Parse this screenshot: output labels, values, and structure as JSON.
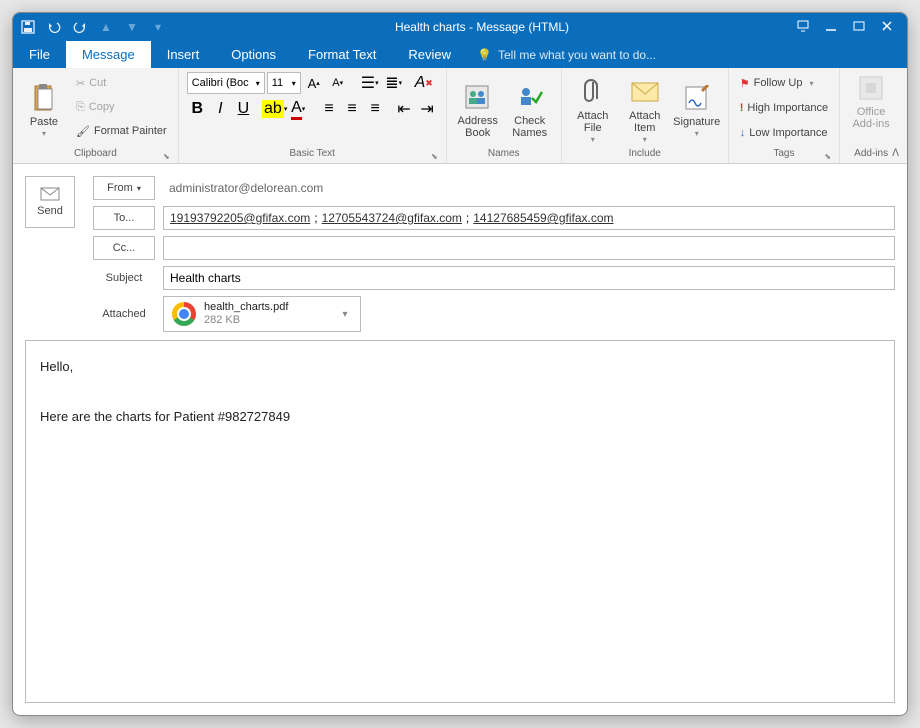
{
  "title": "Health charts - Message (HTML)",
  "menu": {
    "file": "File",
    "message": "Message",
    "insert": "Insert",
    "options": "Options",
    "format": "Format Text",
    "review": "Review",
    "tellme": "Tell me what you want to do..."
  },
  "clipboard": {
    "paste": "Paste",
    "cut": "Cut",
    "copy": "Copy",
    "fmt": "Format Painter",
    "label": "Clipboard"
  },
  "basictext": {
    "font": "Calibri (Boc",
    "size": "11",
    "label": "Basic Text"
  },
  "names": {
    "ab": "Address\nBook",
    "chk": "Check\nNames",
    "label": "Names"
  },
  "include": {
    "af": "Attach\nFile",
    "ai": "Attach\nItem",
    "sig": "Signature",
    "label": "Include"
  },
  "tags": {
    "fu": "Follow Up",
    "hi": "High Importance",
    "li": "Low Importance",
    "label": "Tags"
  },
  "addins": {
    "btn": "Office\nAdd-ins",
    "label": "Add-ins"
  },
  "fields": {
    "fromLabel": "From",
    "from": "administrator@delorean.com",
    "toLabel": "To...",
    "to": [
      "19193792205@gfifax.com",
      "12705543724@gfifax.com",
      "14127685459@gfifax.com"
    ],
    "ccLabel": "Cc...",
    "cc": "",
    "subjectLabel": "Subject",
    "subject": "Health charts",
    "attachedLabel": "Attached",
    "attachName": "health_charts.pdf",
    "attachSize": "282 KB"
  },
  "body": {
    "l1": "Hello,",
    "l2": "Here are the charts for Patient #982727849"
  },
  "send": "Send"
}
